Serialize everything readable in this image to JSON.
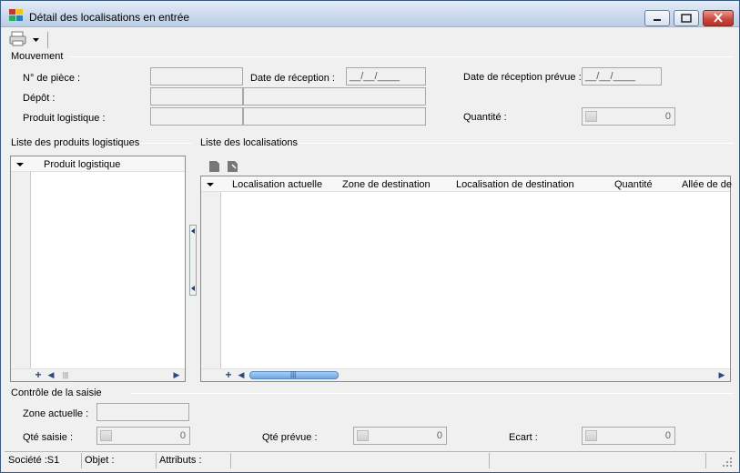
{
  "window": {
    "title": "Détail des localisations en entrée"
  },
  "toolbar": {
    "print_icon": "printer-icon",
    "dropdown_icon": "chevron-down-icon"
  },
  "mouvement": {
    "section_title": "Mouvement",
    "piece_label": "N° de pièce :",
    "piece_value": "",
    "date_reception_label": "Date de réception :",
    "date_reception_value": "__/__/____",
    "date_reception_prevue_label": "Date de réception prévue :",
    "date_reception_prevue_value": "__/__/____",
    "depot_label": "Dépôt :",
    "produit_label": "Produit logistique :",
    "quantite_label": "Quantité :",
    "quantite_value": "0"
  },
  "produits": {
    "section_title": "Liste des produits logistiques",
    "column_header": "Produit logistique",
    "rows": []
  },
  "localisations": {
    "section_title": "Liste des localisations",
    "columns": [
      "Localisation actuelle",
      "Zone de destination",
      "Localisation de destination",
      "Quantité",
      "Allée de de"
    ],
    "rows": []
  },
  "controle": {
    "section_title": "Contrôle de la saisie",
    "zone_label": "Zone actuelle :",
    "zone_value": "",
    "qte_saisie_label": "Qté saisie :",
    "qte_saisie_value": "0",
    "qte_prevue_label": "Qté prévue :",
    "qte_prevue_value": "0",
    "ecart_label": "Ecart :",
    "ecart_value": "0"
  },
  "statusbar": {
    "societe": "Société :S1",
    "objet": "Objet :",
    "attributs": "Attributs :"
  },
  "colors": {
    "window_bg": "#f0f0f0",
    "titlebar": "#c9d8ec",
    "close_button": "#c9443a",
    "scroll_thumb": "#6ea7e0"
  }
}
